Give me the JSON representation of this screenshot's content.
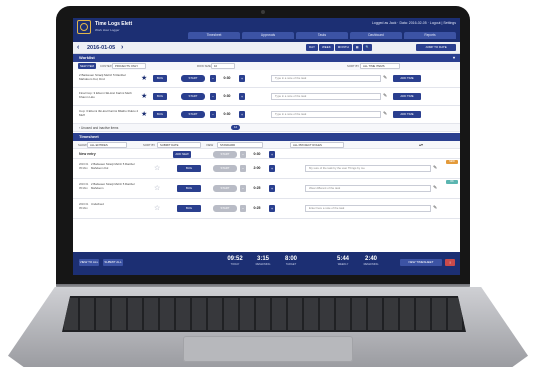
{
  "header": {
    "app_title": "Time Logs Elett",
    "app_subtitle": "Work Hour Logger",
    "user_info": "Logged as Jack · Data: 2016-02-05 · Logout | Settings",
    "tabs": [
      "Timesheet",
      "Approvals",
      "Tasks",
      "Dashboard",
      "Reports"
    ]
  },
  "date_bar": {
    "prev": "‹",
    "date": "2016-01-05",
    "next": "›",
    "views": [
      "DAY",
      "WEEK",
      "MONTH",
      "▦",
      "🔍"
    ],
    "jump_label": "JUMP TO DATE"
  },
  "worklist": {
    "title": "Worklist",
    "new_item": "NEW ITEM",
    "filter1_label": "CONTEXT",
    "filter1_value": "PROJECTS ONLY",
    "filter2_label": "ROW SIZE",
    "filter2_value": "10",
    "filter3_label": "SORT BY",
    "filter3_value": "ALL TIME ITEMS",
    "rows": [
      {
        "title": "2 Barkesen Stracji Mehzi 5 Ranibel Mahdoom Kul, Dnd",
        "bug": "BUG",
        "start": "START",
        "hours": "0:30",
        "note": "Type in a note of the task",
        "add": "ADD TIME"
      },
      {
        "title": "Final Cop: 3 Ebumi 3ki-krel Karimi Meth Khamn Lkio",
        "bug": "BUG",
        "start": "START",
        "hours": "0:30",
        "note": "Type in a note of the task",
        "add": "ADD TIME"
      },
      {
        "title": "Cop: 3 Ebumi 3ki-krel Karimi Mlatho Ruktu 4 Muff",
        "bug": "BUG",
        "start": "START",
        "hours": "0:30",
        "note": "Type in a note of the task",
        "add": "ADD TIME"
      }
    ],
    "unused_label": "Unused and inactive items",
    "unused_count": "12"
  },
  "timesheet": {
    "title": "Timesheet",
    "filter1_label": "SHOW",
    "filter1_value": "ALL ENTRIES",
    "filter2_label": "SORT BY",
    "filter2_value": "SUBMIT DATE",
    "filter3_label": "VIEW",
    "filter3_value": "STANDARD",
    "filter4_value": "ALL PROJECT ROLES",
    "new_entry_label": "New entry",
    "new_entry_add": "ADD NEW",
    "new_entry_start": "START",
    "new_entry_hours": "0:30",
    "rows": [
      {
        "date": "2016 01 05 Mon",
        "desc": "2 Barkesen Stracji Mehzi 5 Ranibel Mahdoom Kul",
        "bug": "BUG",
        "start": "START",
        "hours": "2:00",
        "note": "My sure of the task by the user Things by me",
        "badge": "NEW"
      },
      {
        "date": "2016 01 05 Mon",
        "desc": "2 Barkesen Stracji Mehzi 5 Ranibel Mahdoom",
        "bug": "BUG",
        "start": "START",
        "hours": "0:25",
        "note": "Wear different of the task",
        "badge": "OK"
      },
      {
        "date": "2016 01 05 Mon",
        "desc": "Undefined",
        "bug": "BUG",
        "start": "START",
        "hours": "0:25",
        "note": "Enter here a note of the task",
        "badge": ""
      }
    ]
  },
  "footer": {
    "btn_left1": "VIEW TO ALL",
    "btn_left2": "SUBMIT ALL",
    "stats": [
      {
        "value": "09:52",
        "label": "TODAY"
      },
      {
        "value": "3:15",
        "label": "REMAINING"
      },
      {
        "value": "8:00",
        "label": "TARGET"
      },
      {
        "value": "5:44",
        "label": "WEEKLY"
      },
      {
        "value": "2:40",
        "label": "REMAINING"
      }
    ],
    "new_timesheet": "NEW TIMESHEET",
    "alert_icon": "!"
  },
  "colors": {
    "brand_navy": "#1c2f73",
    "button_blue": "#2a3f8f",
    "accent_gold": "#e1b64a",
    "badge_orange": "#e39a3a",
    "badge_teal": "#5bb5b0"
  }
}
